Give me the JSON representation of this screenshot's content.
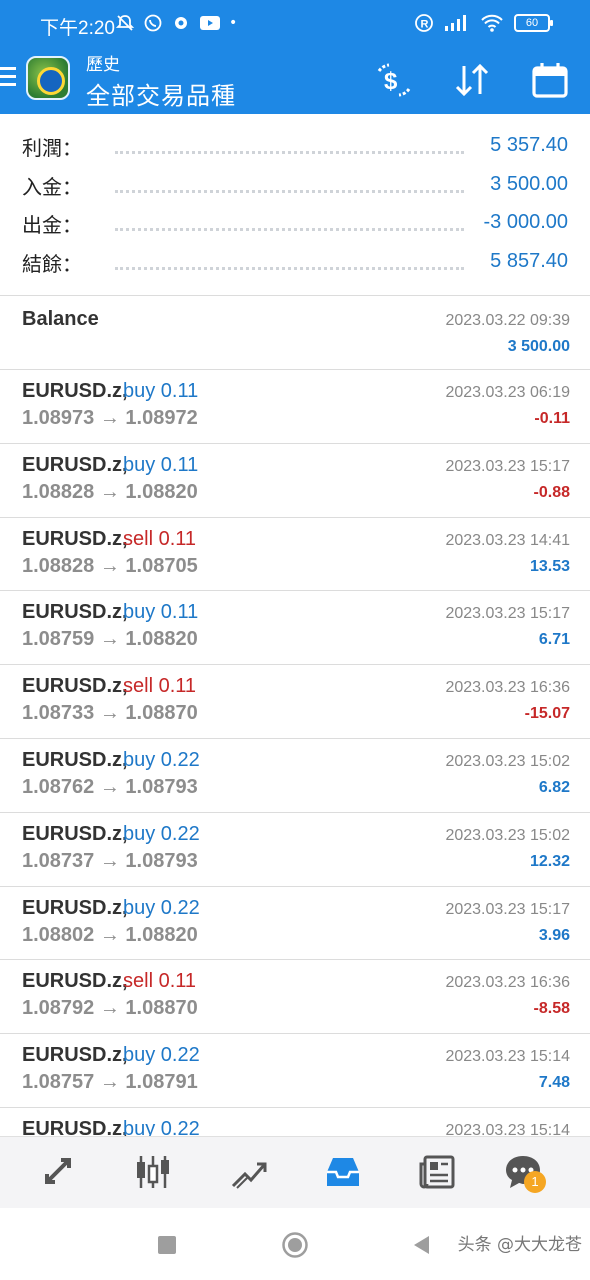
{
  "status_bar": {
    "time": "下午2:20",
    "battery": "60"
  },
  "header": {
    "subtitle": "歷史",
    "title": "全部交易品種"
  },
  "colors": {
    "accent": "#1e88e5",
    "positive": "#1e78c8",
    "negative": "#c62828"
  },
  "summary": [
    {
      "label": "利潤：",
      "value": "5 357.40"
    },
    {
      "label": "入金：",
      "value": "3 500.00"
    },
    {
      "label": "出金：",
      "value": "-3 000.00"
    },
    {
      "label": "結餘：",
      "value": "5 857.40"
    }
  ],
  "balance_entry": {
    "name": "Balance",
    "date": "2023.03.22 09:39",
    "amount": "3 500.00"
  },
  "trades": [
    {
      "symbol": "EURUSD.z,",
      "side": "buy 0.11",
      "dir": "buy",
      "prices": "1.08973 → 1.08972",
      "date": "2023.03.23 06:19",
      "profit": "-0.11",
      "sign": "neg"
    },
    {
      "symbol": "EURUSD.z,",
      "side": "buy 0.11",
      "dir": "buy",
      "prices": "1.08828 → 1.08820",
      "date": "2023.03.23 15:17",
      "profit": "-0.88",
      "sign": "neg"
    },
    {
      "symbol": "EURUSD.z,",
      "side": "sell 0.11",
      "dir": "sell",
      "prices": "1.08828 → 1.08705",
      "date": "2023.03.23 14:41",
      "profit": "13.53",
      "sign": "pos"
    },
    {
      "symbol": "EURUSD.z,",
      "side": "buy 0.11",
      "dir": "buy",
      "prices": "1.08759 → 1.08820",
      "date": "2023.03.23 15:17",
      "profit": "6.71",
      "sign": "pos"
    },
    {
      "symbol": "EURUSD.z,",
      "side": "sell 0.11",
      "dir": "sell",
      "prices": "1.08733 → 1.08870",
      "date": "2023.03.23 16:36",
      "profit": "-15.07",
      "sign": "neg"
    },
    {
      "symbol": "EURUSD.z,",
      "side": "buy 0.22",
      "dir": "buy",
      "prices": "1.08762 → 1.08793",
      "date": "2023.03.23 15:02",
      "profit": "6.82",
      "sign": "pos"
    },
    {
      "symbol": "EURUSD.z,",
      "side": "buy 0.22",
      "dir": "buy",
      "prices": "1.08737 → 1.08793",
      "date": "2023.03.23 15:02",
      "profit": "12.32",
      "sign": "pos"
    },
    {
      "symbol": "EURUSD.z,",
      "side": "buy 0.22",
      "dir": "buy",
      "prices": "1.08802 → 1.08820",
      "date": "2023.03.23 15:17",
      "profit": "3.96",
      "sign": "pos"
    },
    {
      "symbol": "EURUSD.z,",
      "side": "sell 0.11",
      "dir": "sell",
      "prices": "1.08792 → 1.08870",
      "date": "2023.03.23 16:36",
      "profit": "-8.58",
      "sign": "neg"
    },
    {
      "symbol": "EURUSD.z,",
      "side": "buy 0.22",
      "dir": "buy",
      "prices": "1.08757 → 1.08791",
      "date": "2023.03.23 15:14",
      "profit": "7.48",
      "sign": "pos"
    },
    {
      "symbol": "EURUSD.z,",
      "side": "buy 0.22",
      "dir": "buy",
      "prices": "",
      "date": "2023.03.23 15:14",
      "profit": "",
      "sign": "pos"
    }
  ],
  "bottom_nav": {
    "items": [
      "quotes-icon",
      "chart-icon",
      "trade-icon",
      "history-icon",
      "news-icon",
      "chat-icon"
    ],
    "chat_badge": "1"
  },
  "watermark": "头条 @大大龙苍"
}
